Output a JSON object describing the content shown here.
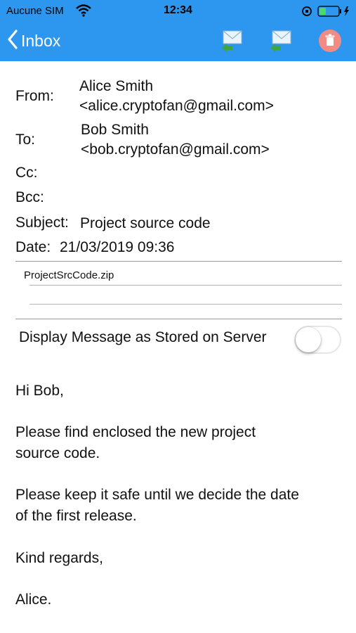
{
  "status_bar": {
    "carrier": "Aucune SIM",
    "time": "12:34",
    "wifi_icon": "wifi-icon",
    "battery_icon": "battery-charging-icon"
  },
  "nav": {
    "back_label": "Inbox",
    "reply_icon": "reply-mail-icon",
    "forward_icon": "forward-mail-icon",
    "delete_icon": "trash-icon",
    "bar_color": "#2d97ef"
  },
  "header": {
    "from_label": "From:",
    "from_name": "Alice Smith",
    "from_email": "<alice.cryptofan@gmail.com>",
    "to_label": "To:",
    "to_name": "Bob Smith",
    "to_email": "<bob.cryptofan@gmail.com>",
    "cc_label": "Cc:",
    "bcc_label": "Bcc:",
    "subject_label": "Subject:",
    "subject_value": "Project source code",
    "date_label": "Date:",
    "date_value": "21/03/2019 09:36"
  },
  "attachments": [
    "ProjectSrcCode.zip"
  ],
  "toggle": {
    "label": "Display Message as Stored on Server",
    "on": false
  },
  "body": {
    "greeting": "Hi Bob,",
    "para1_line1": "Please find enclosed the new project",
    "para1_line2": "source code.",
    "para2_line1": "Please keep it safe until we decide the date",
    "para2_line2": "of the first release.",
    "closing": "Kind regards,",
    "signature": "Alice."
  }
}
